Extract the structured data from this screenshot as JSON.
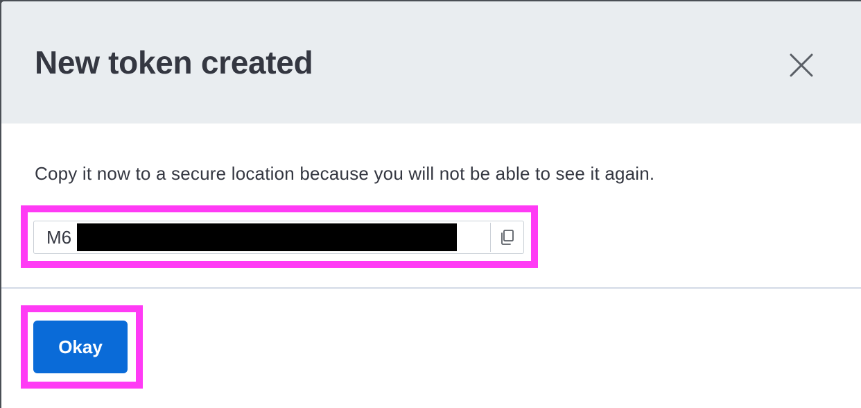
{
  "modal": {
    "title": "New token created",
    "description": "Copy it now to a secure location because you will not be able to see it again.",
    "token": {
      "visible_prefix": "M6"
    },
    "confirm_label": "Okay"
  },
  "icons": {
    "close": "close-icon",
    "copy": "copy-icon"
  },
  "colors": {
    "header_background": "#e9edf0",
    "primary_button": "#0a6bd8",
    "annotation_highlight": "#ff3bf5",
    "text": "#343741"
  }
}
